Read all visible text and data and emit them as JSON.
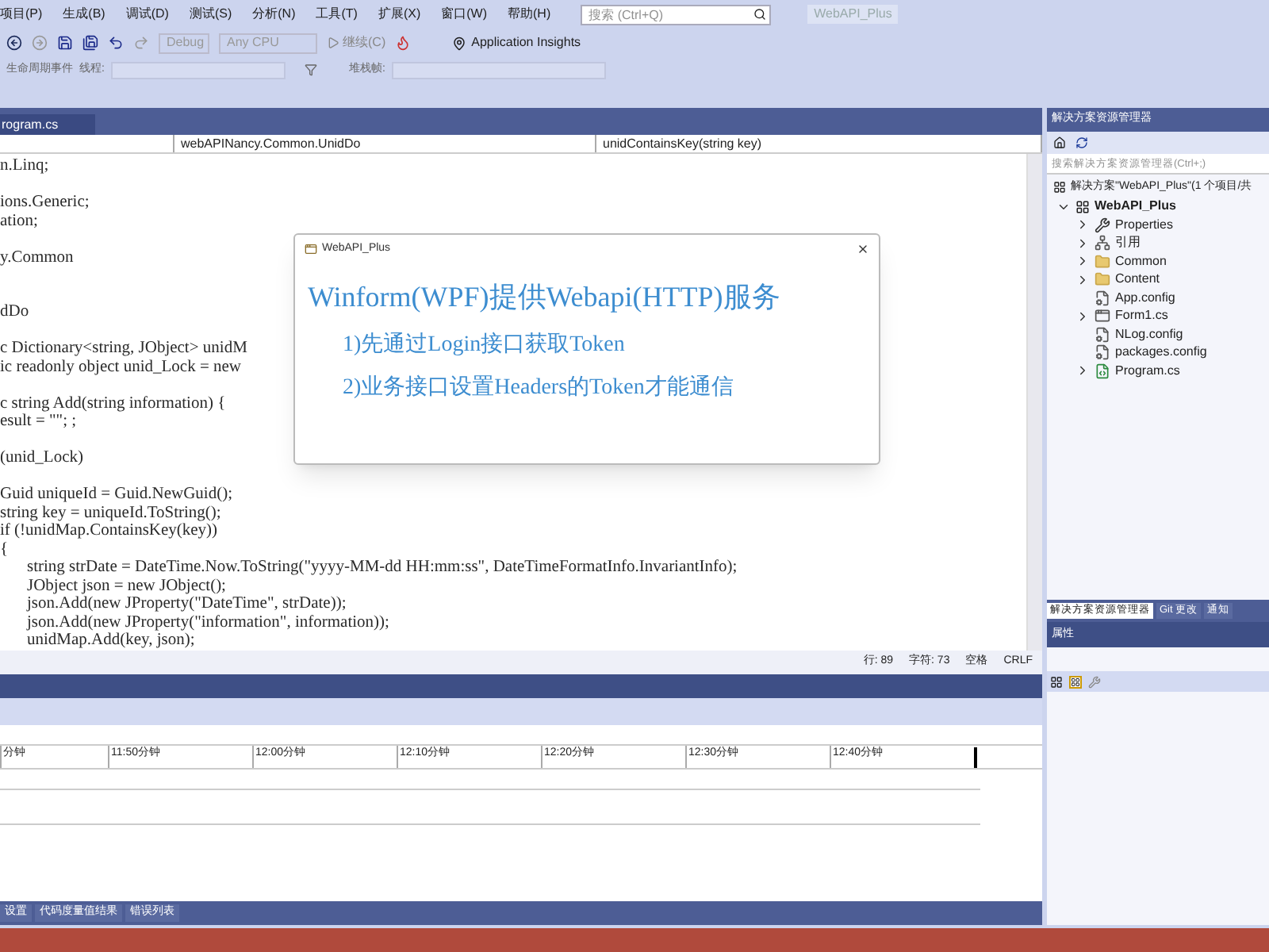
{
  "menu": [
    "项目(P)",
    "生成(B)",
    "调试(D)",
    "测试(S)",
    "分析(N)",
    "工具(T)",
    "扩展(X)",
    "窗口(W)",
    "帮助(H)"
  ],
  "search": {
    "placeholder": "搜索 (Ctrl+Q)"
  },
  "window": {
    "title": "WebAPI_Plus"
  },
  "toolbar": {
    "configuration": "Debug",
    "platform": "Any CPU",
    "continue": "继续(C)",
    "insights": "Application Insights"
  },
  "toolbar2": {
    "lifecycle": "生命周期事件",
    "thread": "线程:",
    "stack": "堆栈帧:"
  },
  "editor": {
    "tab": "rogram.cs",
    "nav": [
      "webAPINancy.Common.UnidDo",
      "unidContainsKey(string key)"
    ],
    "lines": [
      {
        "kind": "code",
        "text": "n.Linq;"
      },
      {
        "kind": "blank"
      },
      {
        "kind": "code",
        "text": "ions.Generic;"
      },
      {
        "kind": "code",
        "text": "ation;"
      },
      {
        "kind": "blank"
      },
      {
        "kind": "code",
        "text": "y.Common"
      },
      {
        "kind": "blank"
      },
      {
        "kind": "blank"
      },
      {
        "kind": "code",
        "text": "dDo"
      },
      {
        "kind": "blank"
      },
      {
        "kind": "code",
        "text": "c Dictionary<string, JObject> unidM"
      },
      {
        "kind": "code",
        "text": "ic readonly object unid_Lock = new"
      },
      {
        "kind": "blank"
      },
      {
        "kind": "code",
        "text": "c string Add(string information) {"
      },
      {
        "kind": "code",
        "text": "esult = \"\"; ;"
      },
      {
        "kind": "blank"
      },
      {
        "kind": "code",
        "text": "(unid_Lock)"
      },
      {
        "kind": "blank"
      },
      {
        "kind": "code",
        "text": "Guid uniqueId = Guid.NewGuid();"
      },
      {
        "kind": "code",
        "text": "string key = uniqueId.ToString();"
      },
      {
        "kind": "code",
        "text": "if (!unidMap.ContainsKey(key))"
      },
      {
        "kind": "code",
        "text": "{",
        "children": [
          {
            "kind": "code",
            "text": "string strDate = DateTime.Now.ToString(\"yyyy-MM-dd HH:mm:ss\", DateTimeFormatInfo.InvariantInfo);"
          },
          {
            "kind": "code",
            "text": "JObject json = new JObject();"
          },
          {
            "kind": "code",
            "text": "json.Add(new JProperty(\"DateTime\", strDate));"
          },
          {
            "kind": "code",
            "text": "json.Add(new JProperty(\"information\", information));"
          },
          {
            "kind": "code",
            "text": "unidMap.Add(key, json);"
          }
        ]
      }
    ],
    "status": [
      "行: 89",
      "字符: 73",
      "空格",
      "CRLF"
    ]
  },
  "dialog": {
    "title": "WebAPI_Plus",
    "heading": "Winform(WPF)提供Webapi(HTTP)服务",
    "lines": [
      "1)先通过Login接口获取Token",
      "2)业务接口设置Headers的Token才能通信"
    ]
  },
  "timeline": {
    "ticks": [
      "分钟",
      "11:50分钟",
      "12:00分钟",
      "12:10分钟",
      "12:20分钟",
      "12:30分钟",
      "12:40分钟"
    ]
  },
  "bottom_tabs": [
    "设置",
    "代码度量值结果",
    "错误列表"
  ],
  "solution_explorer": {
    "title": "解决方案资源管理器",
    "search": {
      "placeholder": "搜索解决方案资源管理器(Ctrl+;)"
    },
    "solution": "解决方案\"WebAPI_Plus\"(1 个项目/共",
    "project": {
      "name": "WebAPI_Plus",
      "expanded": true,
      "children": [
        {
          "name": "Properties",
          "kind": "wrench",
          "expanded": false
        },
        {
          "name": "引用",
          "kind": "refs",
          "expanded": false
        },
        {
          "name": "Common",
          "kind": "folder",
          "expanded": false
        },
        {
          "name": "Content",
          "kind": "folder",
          "expanded": false
        },
        {
          "name": "App.config",
          "kind": "config"
        },
        {
          "name": "Form1.cs",
          "kind": "form",
          "expanded": false
        },
        {
          "name": "NLog.config",
          "kind": "config"
        },
        {
          "name": "packages.config",
          "kind": "config"
        },
        {
          "name": "Program.cs",
          "kind": "csharp",
          "expanded": false
        }
      ]
    },
    "tabs": [
      {
        "label": "解决方案资源管理器",
        "selected": true
      },
      {
        "label": "Git 更改",
        "selected": false
      },
      {
        "label": "通知",
        "selected": false
      }
    ]
  },
  "properties": {
    "title": "属性"
  }
}
